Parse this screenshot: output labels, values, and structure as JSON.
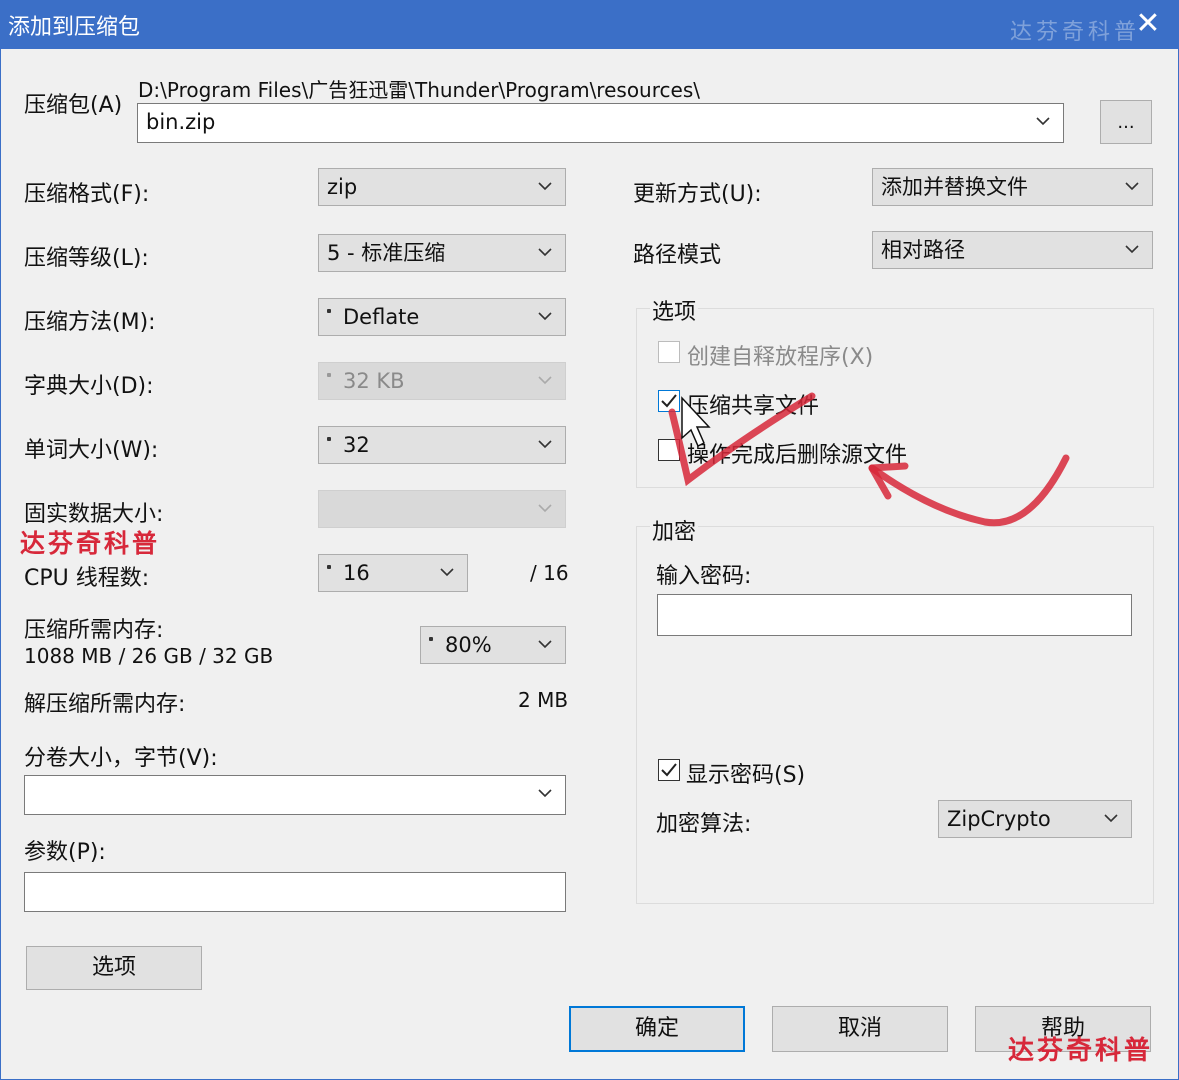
{
  "window": {
    "title": "添加到压缩包",
    "close_glyph": "✕",
    "title_watermark": "达芬奇科普"
  },
  "archive": {
    "label": "压缩包(A)",
    "path": "D:\\Program Files\\广告狂迅雷\\Thunder\\Program\\resources\\",
    "filename": "bin.zip",
    "browse_label": "..."
  },
  "left": {
    "format_label": "压缩格式(F):",
    "format_value": "zip",
    "level_label": "压缩等级(L):",
    "level_value": "5 - 标准压缩",
    "method_label": "压缩方法(M):",
    "method_value": "Deflate",
    "dict_label": "字典大小(D):",
    "dict_value": "32 KB",
    "word_label": "单词大小(W):",
    "word_value": "32",
    "solid_label": "固实数据大小:",
    "solid_value": "",
    "threads_label": "CPU 线程数:",
    "threads_value": "16",
    "threads_total": "/ 16",
    "mem_label": "压缩所需内存:",
    "mem_value": "1088 MB / 26 GB / 32 GB",
    "mem_percent": "80%",
    "unmem_label": "解压缩所需内存:",
    "unmem_value": "2 MB",
    "volume_label": "分卷大小，字节(V):",
    "volume_value": "",
    "params_label": "参数(P):",
    "params_value": "",
    "options_button": "选项"
  },
  "right": {
    "update_label": "更新方式(U):",
    "update_value": "添加并替换文件",
    "path_label": "路径模式",
    "path_value": "相对路径",
    "options_group": "选项",
    "opt_sfx": "创建自释放程序(X)",
    "opt_shared": "压缩共享文件",
    "opt_delete": "操作完成后删除源文件",
    "encrypt_group": "加密",
    "password_label": "输入密码:",
    "password_value": "",
    "show_password": "显示密码(S)",
    "algo_label": "加密算法:",
    "algo_value": "ZipCrypto"
  },
  "buttons": {
    "ok": "确定",
    "cancel": "取消",
    "help": "帮助"
  },
  "watermark": {
    "text": "达芬奇科普",
    "corner_text": "达芬奇科普"
  },
  "colors": {
    "titlebar": "#3b6fc7",
    "accent": "#0078d7",
    "annotation": "#d7283a"
  }
}
